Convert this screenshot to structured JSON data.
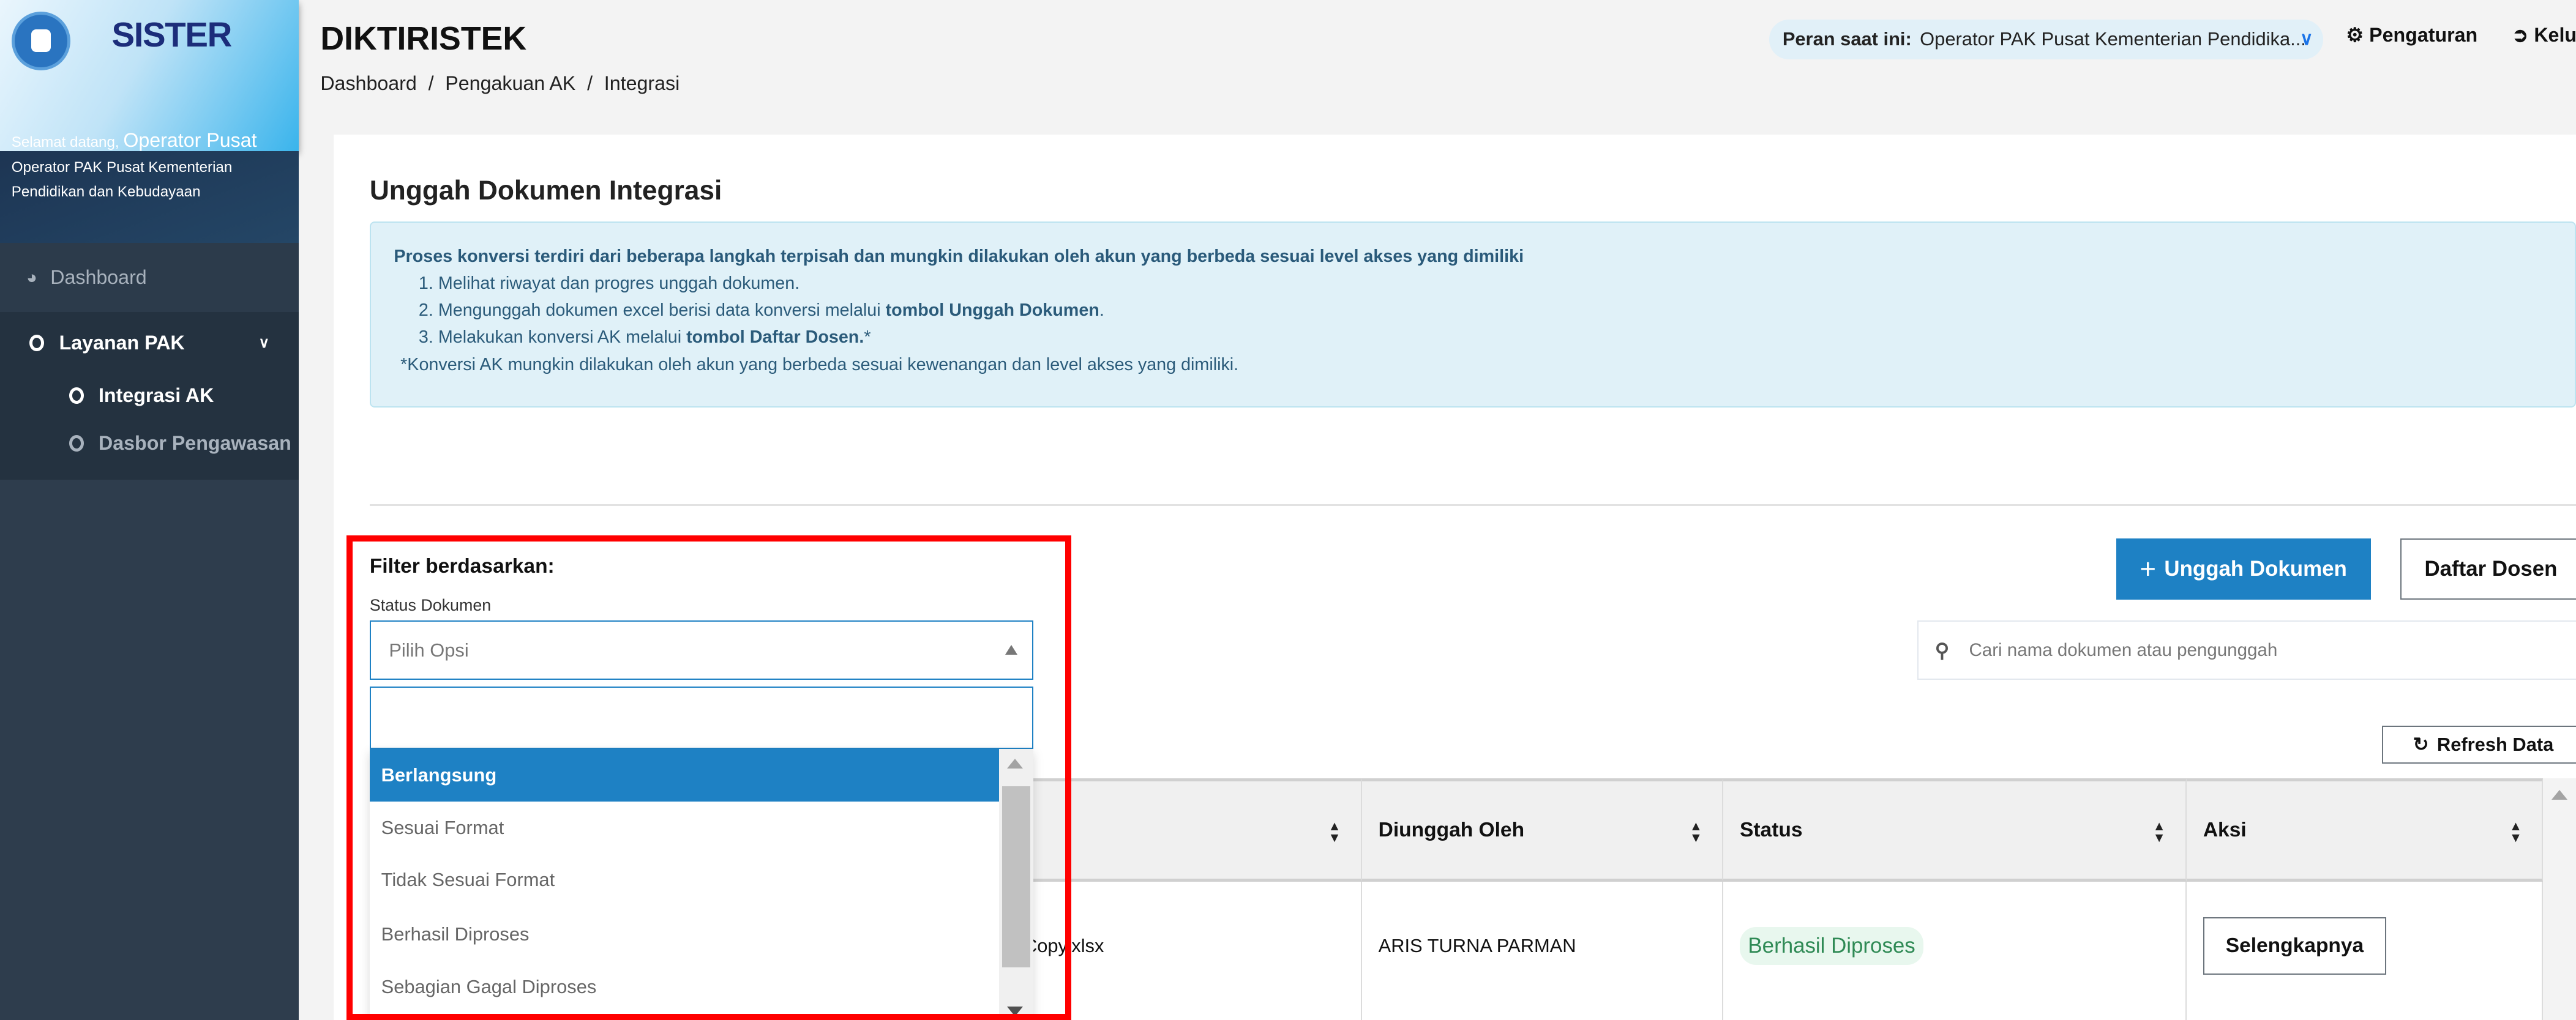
{
  "sidebar": {
    "brand": "SISTER",
    "welcome_prefix": "Selamat datang,",
    "welcome_name": "Operator Pusat",
    "welcome_role": "Operator PAK Pusat Kementerian Pendidikan dan Kebudayaan",
    "items": [
      {
        "label": "Dashboard",
        "icon": "dashboard-gauge-icon"
      },
      {
        "label": "Layanan PAK",
        "icon": "circle-icon",
        "expanded": true,
        "children": [
          {
            "label": "Integrasi AK",
            "active": true
          },
          {
            "label": "Dasbor Pengawasan",
            "active": false
          }
        ]
      }
    ]
  },
  "header": {
    "title": "DIKTIRISTEK",
    "breadcrumb": [
      "Dashboard",
      "Pengakuan AK",
      "Integrasi"
    ],
    "breadcrumb_sep": "/",
    "role_label": "Peran saat ini:",
    "role_value": "Operator PAK Pusat Kementerian Pendidika...",
    "settings": "Pengaturan",
    "logout": "Kelu"
  },
  "main": {
    "title": "Unggah Dokumen Integrasi",
    "info": {
      "heading": "Proses konversi terdiri dari beberapa langkah terpisah dan mungkin dilakukan oleh akun yang berbeda sesuai level akses yang dimiliki",
      "step1": "Melihat riwayat dan progres unggah dokumen.",
      "step2_pre": "Mengunggah dokumen excel berisi data konversi melalui ",
      "step2_bold": "tombol Unggah Dokumen",
      "step2_post": ".",
      "step3_pre": "Melakukan konversi AK melalui ",
      "step3_bold": "tombol Daftar Dosen.",
      "step3_post": "*",
      "note": "*Konversi AK mungkin dilakukan oleh akun yang berbeda sesuai kewenangan dan level akses yang dimiliki."
    },
    "filter": {
      "label": "Filter berdasarkan:",
      "status_label": "Status Dokumen",
      "placeholder": "Pilih Opsi",
      "search_value": "",
      "options": [
        "Berlangsung",
        "Sesuai Format",
        "Tidak Sesuai Format",
        "Berhasil Diproses",
        "Sebagian Gagal Diproses"
      ],
      "highlighted": "Berlangsung"
    },
    "upload_button": "Unggah Dokumen",
    "dosen_button": "Daftar Dosen",
    "search_placeholder": "Cari nama dokumen atau pengunggah",
    "refresh_button": "Refresh Data",
    "table": {
      "columns": [
        "",
        "Diunggah Oleh",
        "Status",
        "Aksi"
      ],
      "rows": [
        {
          "document": "Copy.xlsx",
          "uploader": "ARIS TURNA PARMAN",
          "status": "Berhasil Diproses",
          "action": "Selengkapnya"
        }
      ]
    }
  },
  "colors": {
    "primary": "#1e81c4",
    "sidebar": "#2e3d4d",
    "status_success": "#2f8a55",
    "highlight_box": "#ff0000"
  }
}
